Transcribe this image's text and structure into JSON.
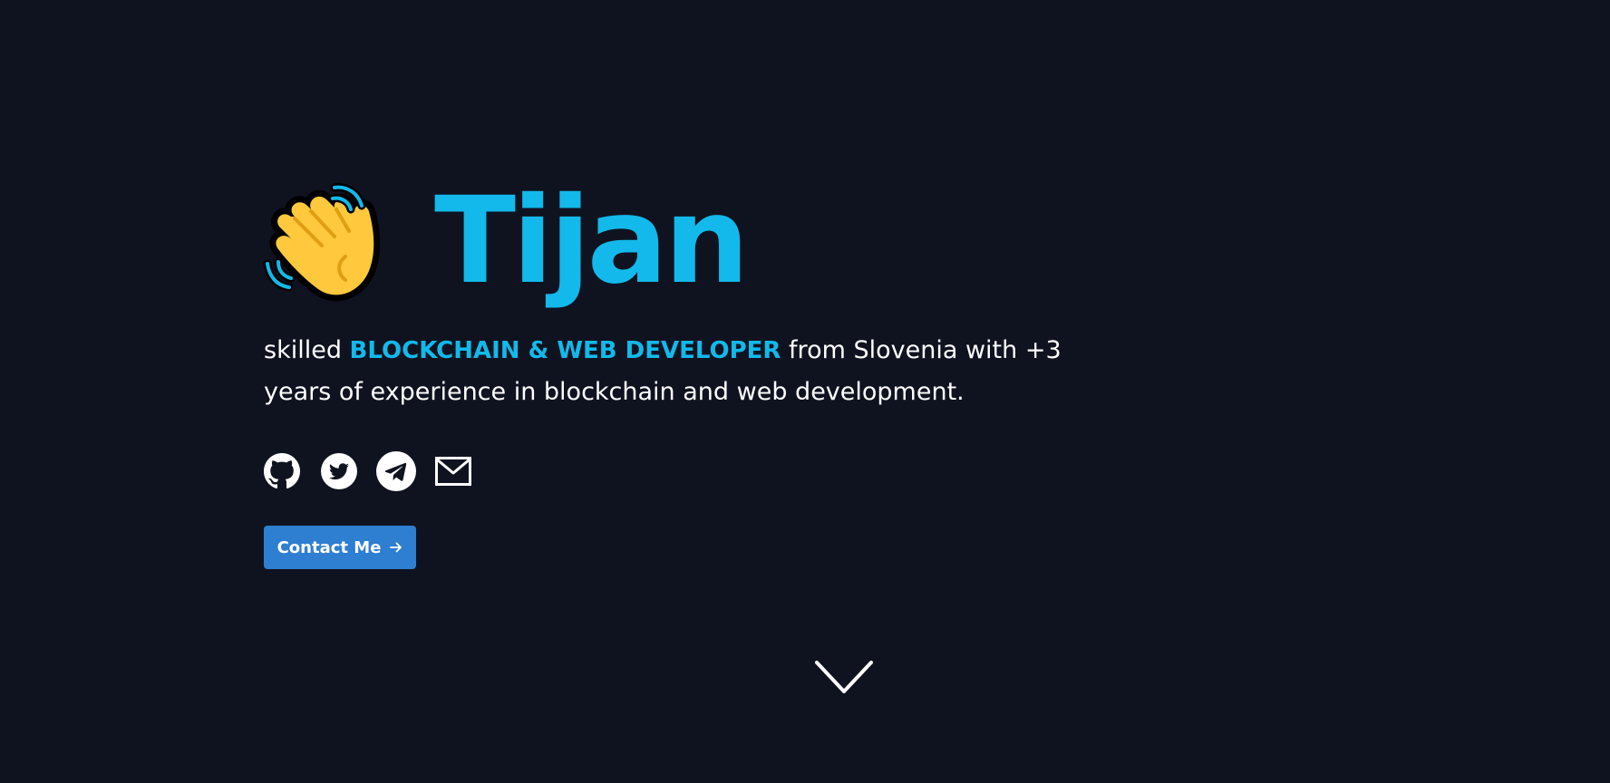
{
  "hero": {
    "name": "Tijan",
    "wave_icon": "waving-hand-icon",
    "description": {
      "prefix": "skilled ",
      "role": "BLOCKCHAIN & WEB DEVELOPER",
      "suffix": " from Slovenia with +3 years of experience in blockchain and web development."
    }
  },
  "socials": [
    {
      "icon": "github-icon"
    },
    {
      "icon": "twitter-icon"
    },
    {
      "icon": "telegram-icon"
    },
    {
      "icon": "mail-icon"
    }
  ],
  "contact_button": {
    "label": "Contact Me",
    "icon": "arrow-right-icon"
  },
  "scroll_indicator": {
    "icon": "chevron-down-icon"
  },
  "colors": {
    "background": "#0f1320",
    "accent": "#12b9ea",
    "button": "#2e7ed1",
    "text": "#ffffff"
  }
}
